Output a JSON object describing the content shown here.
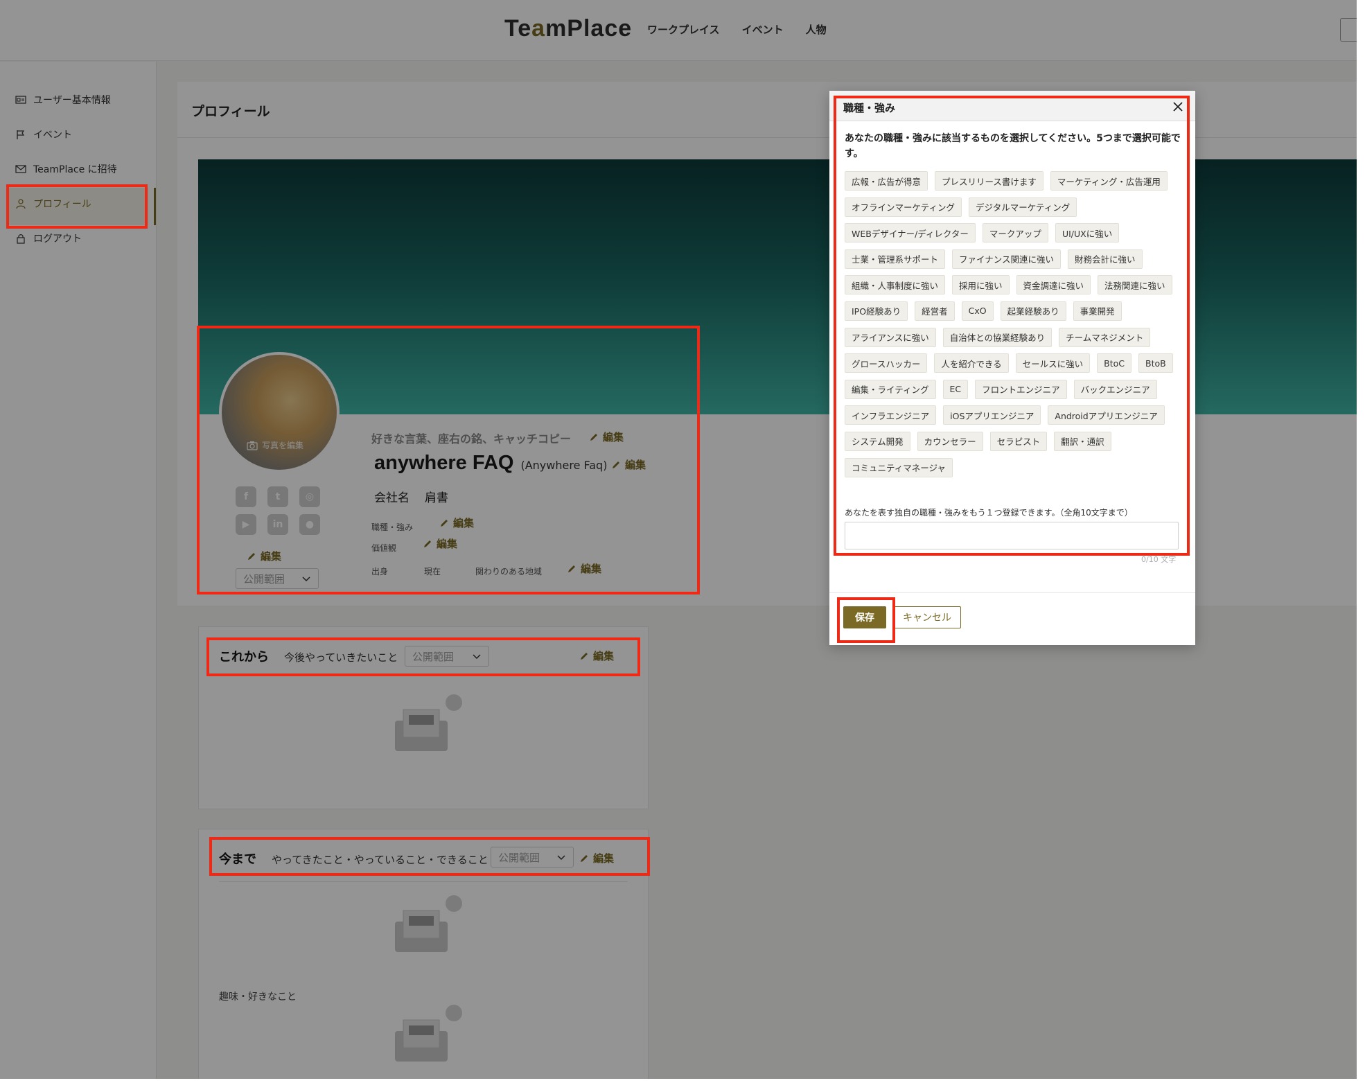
{
  "header": {
    "logo_prefix": "Te",
    "logo_accent": "a",
    "logo_suffix": "mPlace",
    "nav": [
      "ワークプレイス",
      "イベント",
      "人物"
    ]
  },
  "sidebar": {
    "items": [
      {
        "label": "ユーザー基本情報",
        "icon": "id-card-icon"
      },
      {
        "label": "イベント",
        "icon": "flag-icon"
      },
      {
        "label": "TeamPlace に招待",
        "icon": "mail-icon"
      },
      {
        "label": "プロフィール",
        "icon": "user-icon",
        "active": true
      },
      {
        "label": "ログアウト",
        "icon": "lock-icon"
      }
    ]
  },
  "profile": {
    "page_title": "プロフィール",
    "avatar_label": "写真を編集",
    "catchphrase": "好きな言葉、座右の銘、キャッチコピー",
    "edit": "編集",
    "name": "anywhere FAQ",
    "name_reading": "(Anywhere Faq)",
    "company": "会社名",
    "position": "肩書",
    "job_label": "職種・強み",
    "values_label": "価値観",
    "origin_label": "出身",
    "current_label": "現在",
    "region_label": "関わりのある地域",
    "visibility_placeholder": "公開範囲",
    "social": [
      "facebook-icon",
      "twitter-icon",
      "instagram-icon",
      "youtube-icon",
      "linkedin-icon",
      "github-icon"
    ]
  },
  "sections": {
    "future_title": "これから",
    "future_sub": "今後やっていきたいこと",
    "past_title": "今まで",
    "past_sub": "やってきたこと・やっていること・できること",
    "hobby_label": "趣味・好きなこと"
  },
  "modal": {
    "title": "職種・強み",
    "description": "あなたの職種・強みに該当するものを選択してください。5つまで選択可能です。",
    "tag_rows": [
      [
        "広報・広告が得意",
        "プレスリリース書けます",
        "マーケティング・広告運用"
      ],
      [
        "オフラインマーケティング",
        "デジタルマーケティング"
      ],
      [
        "WEBデザイナー/ディレクター",
        "マークアップ",
        "UI/UXに強い"
      ],
      [
        "士業・管理系サポート",
        "ファイナンス関連に強い",
        "財務会計に強い"
      ],
      [
        "組織・人事制度に強い",
        "採用に強い",
        "資金調達に強い",
        "法務関連に強い"
      ],
      [
        "IPO経験あり",
        "経営者",
        "CxO",
        "起業経験あり",
        "事業開発"
      ],
      [
        "アライアンスに強い",
        "自治体との協業経験あり",
        "チームマネジメント"
      ],
      [
        "グロースハッカー",
        "人を紹介できる",
        "セールスに強い",
        "BtoC",
        "BtoB"
      ],
      [
        "編集・ライティング",
        "EC",
        "フロントエンジニア",
        "バックエンジニア"
      ],
      [
        "インフラエンジニア",
        "iOSアプリエンジニア",
        "Androidアプリエンジニア"
      ],
      [
        "システム開発",
        "カウンセラー",
        "セラピスト",
        "翻訳・通訳"
      ],
      [
        "コミュニティマネージャ"
      ]
    ],
    "custom_label": "あなたを表す独自の職種・強みをもう１つ登録できます。（全角10文字まで）",
    "custom_value": "",
    "char_count": "0/10 文字",
    "save": "保存",
    "cancel": "キャンセル"
  },
  "colors": {
    "accent": "#7a6a25",
    "highlight": "#ee2a16"
  }
}
